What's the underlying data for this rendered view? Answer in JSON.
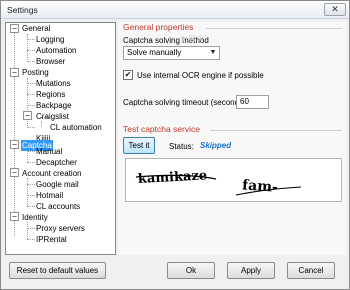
{
  "window": {
    "title": "Settings",
    "close_glyph": "✕"
  },
  "tree": {
    "items": [
      {
        "label": "General",
        "expander": "−"
      },
      {
        "label": "Logging"
      },
      {
        "label": "Automation"
      },
      {
        "label": "Browser"
      },
      {
        "label": "Posting",
        "expander": "−"
      },
      {
        "label": "Mutations"
      },
      {
        "label": "Regions"
      },
      {
        "label": "Backpage"
      },
      {
        "label": "Craigslist",
        "expander": "−"
      },
      {
        "label": "CL automation"
      },
      {
        "label": "Kijiji"
      },
      {
        "label": "Captcha",
        "expander": "−",
        "selected": true
      },
      {
        "label": "Manual"
      },
      {
        "label": "Decaptcher"
      },
      {
        "label": "Account creation",
        "expander": "−"
      },
      {
        "label": "Google mail"
      },
      {
        "label": "Hotmail"
      },
      {
        "label": "CL accounts"
      },
      {
        "label": "Identity",
        "expander": "−"
      },
      {
        "label": "Proxy servers"
      },
      {
        "label": "IPRental"
      }
    ]
  },
  "general_properties": {
    "title": "General properties",
    "method_label": "Captcha solving method",
    "method_value": "Solve manually",
    "ocr_label": "Use internal OCR engine if possible",
    "ocr_checked": true,
    "timeout_label": "Captcha solving timeout (seconds)",
    "timeout_value": "60"
  },
  "test_service": {
    "title": "Test captcha service",
    "test_button": "Test it",
    "status_label": "Status:",
    "status_value": "Skipped",
    "captcha_words": [
      "kamikaze",
      "fam-"
    ]
  },
  "footer": {
    "reset_button": "Reset to default values",
    "ok_button": "Ok",
    "apply_button": "Apply",
    "cancel_button": "Cancel"
  },
  "colors": {
    "section_title": "#c0392b",
    "selection": "#3399ff",
    "status": "#1a6fc9"
  }
}
